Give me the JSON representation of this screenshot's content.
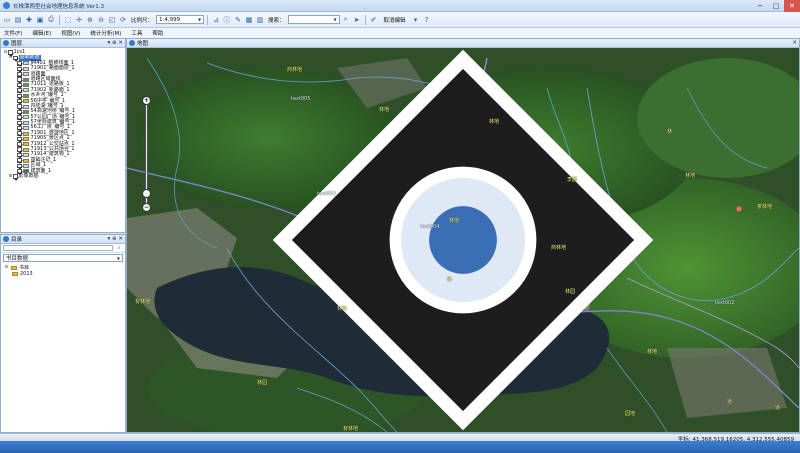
{
  "window": {
    "title": "长株潭两型社会地理信息系统 Ver1.3",
    "minimize": "─",
    "maximize": "□",
    "close": "✕"
  },
  "toolbar": {
    "scale_label": "比例尺：",
    "scale_value": "1:4,999",
    "search_label": "搜索：",
    "search_value": "",
    "cancel_edit": "取消编辑"
  },
  "menu": [
    "文件(F)",
    "编辑(E)",
    "视图(V)",
    "统计分析(M)",
    "工具",
    "帮助"
  ],
  "layers_panel": {
    "title": "图层",
    "controls": "▾ ⊕ ✕",
    "root": "1cs1",
    "group1": "基础数据",
    "items": [
      "JM401_植被线面_1",
      "71901_路面面层_1",
      "道路面",
      "道路区域面线",
      "71011_道路板_1",
      "71902_新路面_1",
      "水乡河_编号_1",
      "56中学_编号_1",
      "内陆湖_编号_1",
      "54高速河桥_编号_1",
      "57公园广场_编号_1",
      "57坐标建筑_编号_1",
      "56工厂房_编号_1",
      "71901_旅游地区_1",
      "71905_景区点_1",
      "71912_公交站点_1",
      "71913_公共场合_1",
      "71914_建筑物_1",
      "基础注记_1",
      "区域_1",
      "建筑面_1"
    ],
    "group2": "影像数据"
  },
  "catalog_panel": {
    "title": "目录",
    "controls": "▾ ⊕ ✕",
    "combo_value": "书目数据",
    "root": "书目",
    "child": "2013"
  },
  "map_panel": {
    "title": "地图",
    "controls": "✕"
  },
  "map_labels": {
    "a": "商林地",
    "b": "text005",
    "c": "text001",
    "d": "林地",
    "e": "李园",
    "f": "林地",
    "g": "text004",
    "h": "林地",
    "i": "茶林地",
    "j": "商林地",
    "k": "text002",
    "l": "有林地",
    "m": "林地",
    "n": "林园",
    "o": "有林地",
    "p": "林园",
    "q": "园地",
    "r": "道",
    "s": "道",
    "t": "新",
    "u": "林地",
    "v": "林",
    "w": "林地"
  },
  "status": {
    "coord": "坐标: 41,368,519.16205, 4,312,555.40859"
  },
  "colors": {
    "accent": "#2b5fa6",
    "label": "#f4f17a"
  }
}
